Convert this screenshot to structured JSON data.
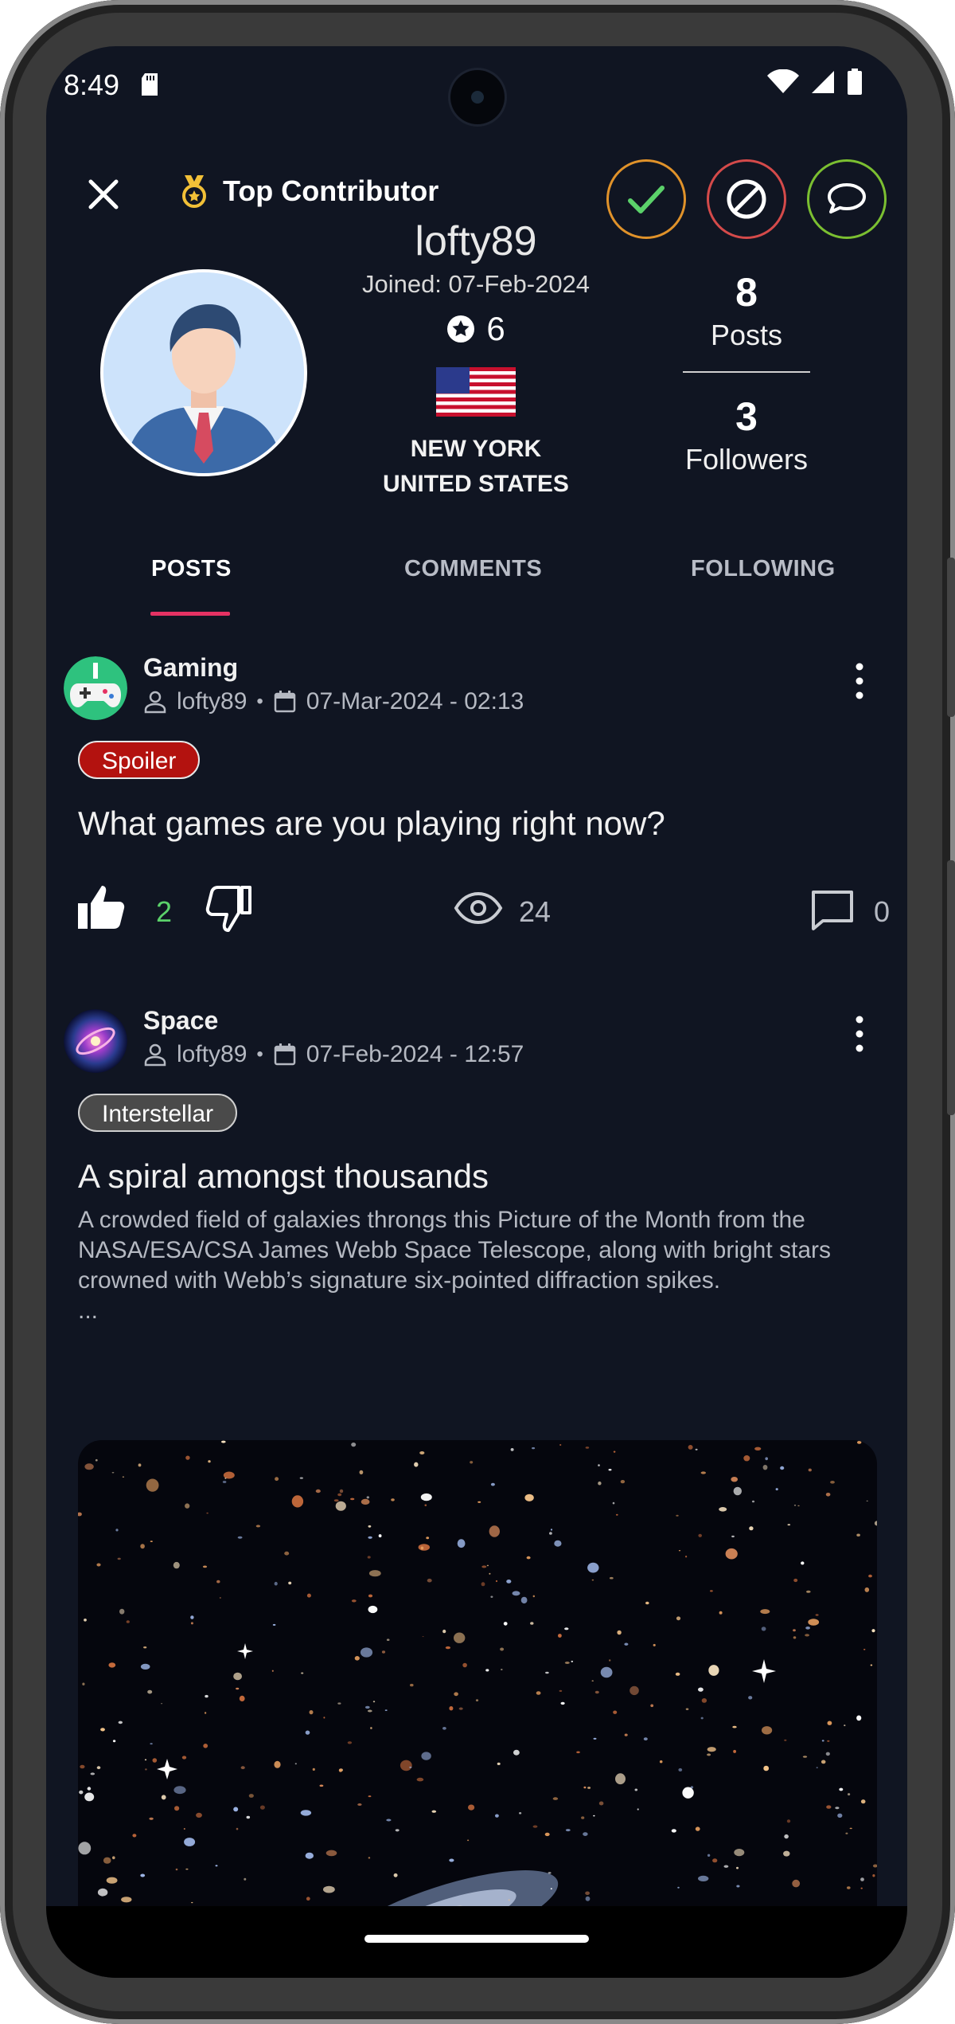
{
  "status_bar": {
    "time": "8:49"
  },
  "header": {
    "badge_label": "Top Contributor",
    "actions": [
      "approve",
      "block",
      "message"
    ]
  },
  "profile": {
    "username": "lofty89",
    "joined": "Joined: 07-Feb-2024",
    "rating": "6",
    "city": "NEW YORK",
    "country": "UNITED STATES",
    "posts_count": "8",
    "posts_label": "Posts",
    "followers_count": "3",
    "followers_label": "Followers"
  },
  "tabs": [
    {
      "label": "POSTS",
      "active": true
    },
    {
      "label": "COMMENTS",
      "active": false
    },
    {
      "label": "FOLLOWING",
      "active": false
    }
  ],
  "posts": [
    {
      "community": "Gaming",
      "author": "lofty89",
      "date": "07-Mar-2024 - 02:13",
      "tag": "Spoiler",
      "title": "What games are you playing right now?",
      "likes": "2",
      "views": "24",
      "comments": "0"
    },
    {
      "community": "Space",
      "author": "lofty89",
      "date": "07-Feb-2024 - 12:57",
      "tag": "Interstellar",
      "title": "A spiral amongst thousands",
      "body": "A crowded field of galaxies throngs this Picture of the Month from the NASA/ESA/CSA James Webb Space Telescope, along with bright stars crowned with Webb’s signature six-pointed diffraction spikes.",
      "ellipsis": "..."
    }
  ],
  "colors": {
    "background": "#101522",
    "tab_indicator": "#e53263",
    "approve_ring": "#e0922a",
    "approve_check": "#5bd16a",
    "block_ring": "#d44a4a",
    "message_ring": "#7bbf31",
    "spoiler_tag": "#b3120f",
    "like_count": "#5bd16a"
  },
  "icons": [
    "close-icon",
    "medal-icon",
    "check-icon",
    "block-icon",
    "chat-bubble-icon",
    "star-circle-icon",
    "us-flag-icon",
    "user-icon",
    "calendar-icon",
    "more-vert-icon",
    "thumb-up-icon",
    "thumb-down-icon",
    "eye-icon",
    "comment-icon"
  ]
}
